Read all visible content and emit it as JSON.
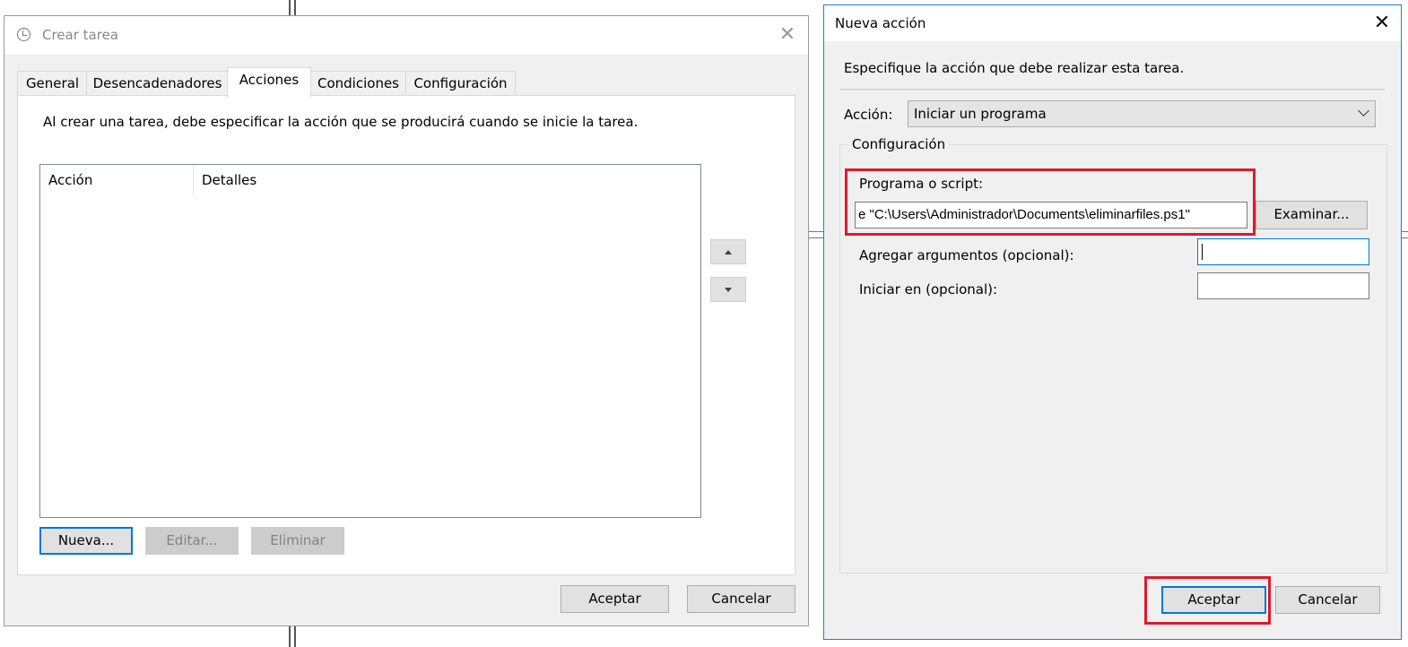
{
  "crear_tarea": {
    "title": "Crear tarea",
    "tabs": [
      "General",
      "Desencadenadores",
      "Acciones",
      "Condiciones",
      "Configuración"
    ],
    "active_tab": "Acciones",
    "description": "Al crear una tarea, debe especificar la acción que se producirá cuando se inicie la tarea.",
    "columns": [
      "Acción",
      "Detalles"
    ],
    "buttons": {
      "nueva": "Nueva...",
      "editar": "Editar...",
      "eliminar": "Eliminar",
      "aceptar": "Aceptar",
      "cancelar": "Cancelar"
    }
  },
  "nueva_accion": {
    "title": "Nueva acción",
    "instruction": "Especifique la acción que debe realizar esta tarea.",
    "accion_label": "Acción:",
    "accion_value": "Iniciar un programa",
    "group_title": "Configuración",
    "programa_label": "Programa o script:",
    "programa_value": "e \"C:\\Users\\Administrador\\Documents\\eliminarfiles.ps1\"",
    "examinar": "Examinar...",
    "argumentos_label": "Agregar argumentos (opcional):",
    "argumentos_value": "",
    "iniciar_label": "Iniciar en (opcional):",
    "iniciar_value": "",
    "buttons": {
      "aceptar": "Aceptar",
      "cancelar": "Cancelar"
    }
  },
  "colors": {
    "highlight": "#e0192b",
    "focus": "#0078d7"
  }
}
